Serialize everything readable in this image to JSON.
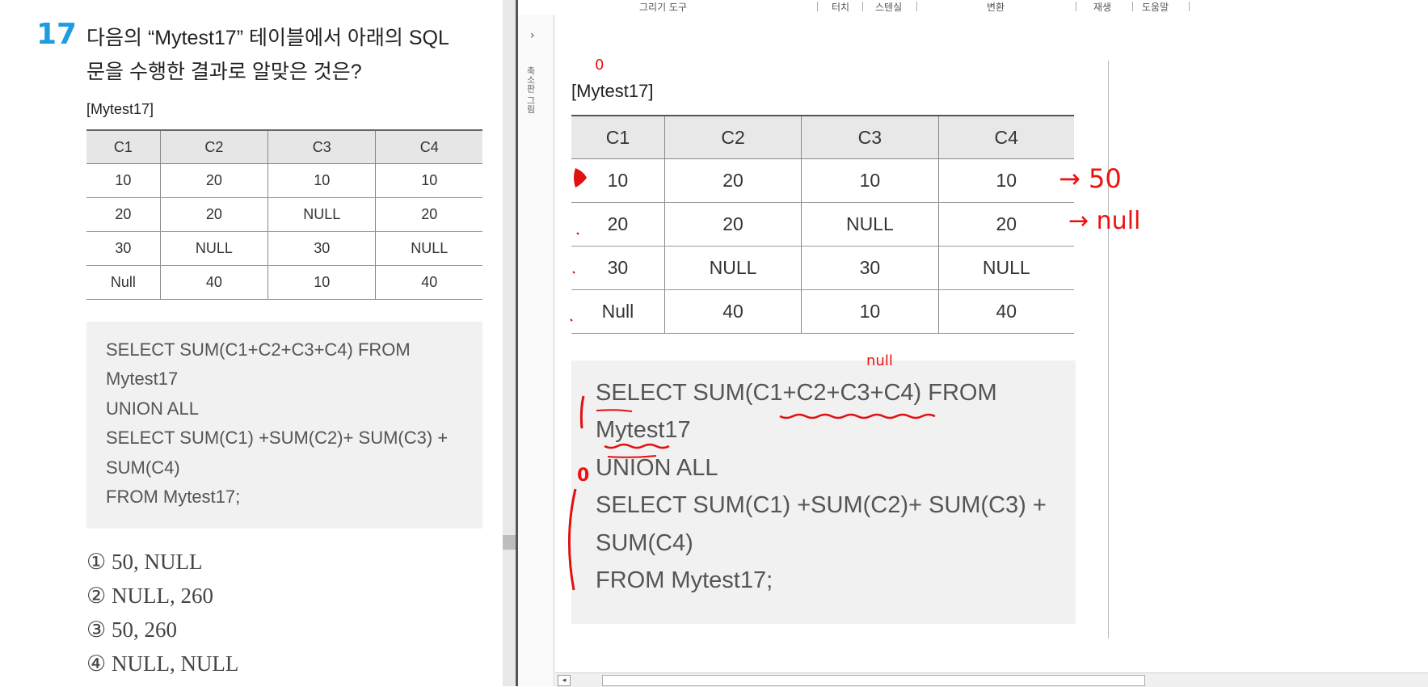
{
  "question": {
    "number": "17",
    "text_line1": "다음의 “Mytest17” 테이블에서 아래의 SQL",
    "text_line2": "문을 수행한 결과로 알맞은 것은?",
    "table_caption": "[Mytest17]",
    "table": {
      "headers": [
        "C1",
        "C2",
        "C3",
        "C4"
      ],
      "rows": [
        [
          "10",
          "20",
          "10",
          "10"
        ],
        [
          "20",
          "20",
          "NULL",
          "20"
        ],
        [
          "30",
          "NULL",
          "30",
          "NULL"
        ],
        [
          "Null",
          "40",
          "10",
          "40"
        ]
      ]
    },
    "sql_lines": [
      "SELECT SUM(C1+C2+C3+C4) FROM",
      "Mytest17",
      "UNION ALL",
      "SELECT SUM(C1) +SUM(C2)+ SUM(C3) +",
      "SUM(C4)",
      "FROM Mytest17;"
    ],
    "options": [
      "① 50, NULL",
      "② NULL, 260",
      "③ 50, 260",
      "④ NULL, NULL"
    ]
  },
  "ribbon": {
    "groups": [
      "그리기 도구",
      "터치",
      "스텐실",
      "변환",
      "재생",
      "도움말"
    ]
  },
  "side_panel": {
    "chevron": "›",
    "label": "축소판 그림"
  },
  "slide": {
    "table_caption": "[Mytest17]",
    "table": {
      "headers": [
        "C1",
        "C2",
        "C3",
        "C4"
      ],
      "rows": [
        [
          "10",
          "20",
          "10",
          "10"
        ],
        [
          "20",
          "20",
          "NULL",
          "20"
        ],
        [
          "30",
          "NULL",
          "30",
          "NULL"
        ],
        [
          "Null",
          "40",
          "10",
          "40"
        ]
      ]
    },
    "sql_lines": [
      "SELECT SUM(C1+C2+C3+C4) FROM",
      "Mytest17",
      "UNION ALL",
      "SELECT SUM(C1) +SUM(C2)+ SUM(C3) +",
      "SUM(C4)",
      "FROM Mytest17;"
    ]
  },
  "annotations": {
    "row1_result": "→ 50",
    "row2_result": "→ null",
    "above_sum": "null",
    "top_mark": "0",
    "union_mark": "0"
  },
  "colors": {
    "accent_blue": "#1f9be0",
    "ink_red": "#e01111",
    "table_header_bg": "#e6e6e6",
    "code_bg": "#f1f1f1"
  }
}
